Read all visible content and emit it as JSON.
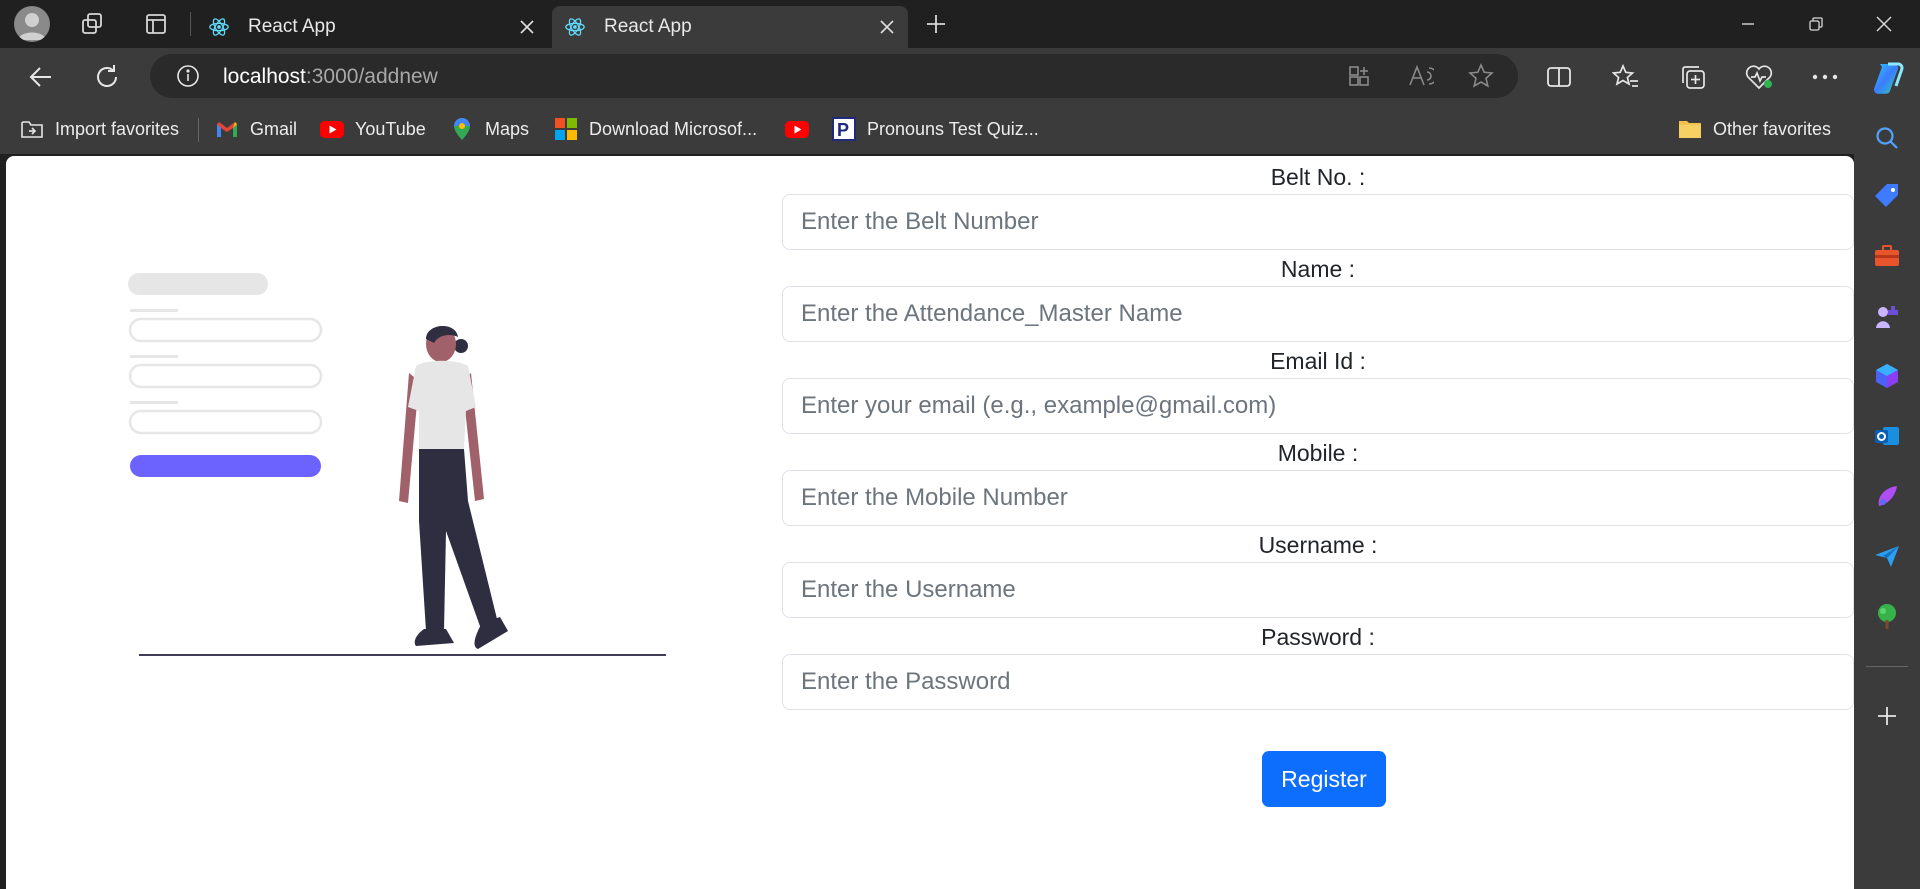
{
  "browser": {
    "tabs": [
      {
        "title": "React App",
        "active": false
      },
      {
        "title": "React App",
        "active": true
      }
    ],
    "address": {
      "host": "localhost",
      "path": ":3000/addnew"
    },
    "favorites": [
      {
        "label": "Import favorites",
        "icon": "import-icon"
      },
      {
        "label": "Gmail",
        "icon": "gmail-icon"
      },
      {
        "label": "YouTube",
        "icon": "youtube-icon"
      },
      {
        "label": "Maps",
        "icon": "maps-icon"
      },
      {
        "label": "Download Microsof...",
        "icon": "microsoft-icon"
      },
      {
        "label": "",
        "icon": "youtube-icon"
      },
      {
        "label": "Pronouns Test Quiz...",
        "icon": "pronouns-icon"
      }
    ],
    "other_favorites": "Other favorites"
  },
  "form": {
    "fields": [
      {
        "label": "Belt No. :",
        "placeholder": "Enter the Belt Number"
      },
      {
        "label": "Name :",
        "placeholder": "Enter the Attendance_Master Name"
      },
      {
        "label": "Email Id :",
        "placeholder": "Enter your email (e.g., example@gmail.com)"
      },
      {
        "label": "Mobile :",
        "placeholder": "Enter the Mobile Number"
      },
      {
        "label": "Username :",
        "placeholder": "Enter the Username"
      },
      {
        "label": "Password :",
        "placeholder": "Enter the Password"
      }
    ],
    "submit_label": "Register"
  },
  "colors": {
    "primary": "#0d6efd",
    "illustration_accent": "#6c63ff",
    "chrome_dark": "#202020",
    "chrome_toolbar": "#3b3b3b"
  }
}
